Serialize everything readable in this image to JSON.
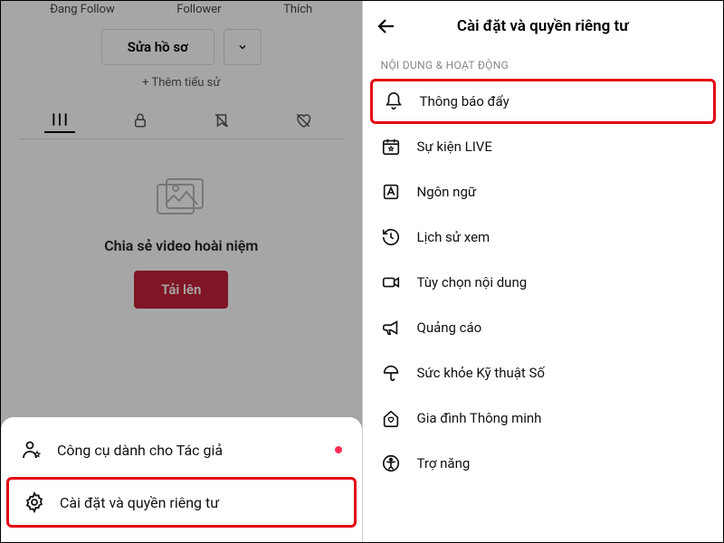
{
  "left": {
    "stats": {
      "following": "Đang Follow",
      "follower": "Follower",
      "likes": "Thích"
    },
    "edit_label": "Sửa hồ sơ",
    "bio_label": "+ Thêm tiểu sử",
    "empty_title": "Chia sẻ video hoài niệm",
    "upload_label": "Tải lên",
    "sheet": {
      "creator_tools": "Công cụ dành cho Tác giả",
      "settings": "Cài đặt và quyền riêng tư"
    }
  },
  "right": {
    "title": "Cài đặt và quyền riêng tư",
    "section": "NỘI DUNG & HOẠT ĐỘNG",
    "items": {
      "push": "Thông báo đẩy",
      "live": "Sự kiện LIVE",
      "lang": "Ngôn ngữ",
      "history": "Lịch sử xem",
      "content_pref": "Tùy chọn nội dung",
      "ads": "Quảng cáo",
      "wellbeing": "Sức khỏe Kỹ thuật Số",
      "family": "Gia đình Thông minh",
      "accessibility": "Trợ năng"
    }
  }
}
